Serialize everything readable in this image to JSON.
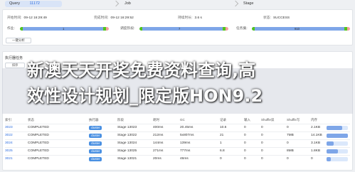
{
  "breadcrumb": {
    "query_label": "Query",
    "query_id": "11172",
    "job_label": "Job",
    "stage_label": "Stage"
  },
  "summary": {
    "start_time_label": "开始时间:",
    "start_time": "09-12 16:29:49",
    "end_time_label": "完成时间:",
    "end_time": "09-12 16:29:52",
    "duration_label": "持续时长:",
    "duration": "3.6 s",
    "status_label": "状态:",
    "status": "SUCCESS",
    "jobs_label": "作业:",
    "jobs_done": "1",
    "schedule_label": "调度阶段:",
    "schedule_done": "7",
    "tasks_label": "任务集:",
    "tasks_done": "910"
  },
  "buttons": {
    "reset": "一键分析",
    "filter": "排序"
  },
  "tasks": {
    "title": "执行器任务",
    "columns": [
      "索引",
      "状态",
      "执行器",
      "阶段",
      "耗时",
      "GC",
      "记录",
      "输入",
      "Shuffle读",
      "Shuffle写",
      "内存"
    ],
    "rows": [
      {
        "id": "3023",
        "status": "COMPLETED",
        "exec": "cluster",
        "stage": "Stage 13023",
        "time": "400ms",
        "gc": "20.45ms",
        "rec": "10.6",
        "a": "0",
        "b": "0",
        "c": "0",
        "size": "2.1KB"
      },
      {
        "id": "3022",
        "status": "COMPLETED",
        "exec": "cluster",
        "stage": "Stage 13022",
        "time": "212ms",
        "gc": "5x807ms",
        "rec": "21",
        "a": "0",
        "b": "0",
        "c": "7MB",
        "size": "14.1KB"
      },
      {
        "id": "3024",
        "status": "COMPLETED",
        "exec": "cluster",
        "stage": "Stage 13024",
        "time": "144ms",
        "gc": "139ms",
        "rec": "1",
        "a": "0",
        "b": "0",
        "c": "0",
        "size": "3.1KB"
      },
      {
        "id": "3025",
        "status": "COMPLETED",
        "exec": "cluster",
        "stage": "Stage 13025",
        "time": "271ms",
        "gc": "777ms",
        "rec": "6.8",
        "a": "0",
        "b": "0",
        "c": "8MB",
        "size": "1.8KB"
      },
      {
        "id": "3021",
        "status": "COMPLETED",
        "exec": "cluster",
        "stage": "Stage 13021",
        "time": "20ms",
        "gc": "46ms",
        "rec": "0",
        "a": "0",
        "b": "0",
        "c": "0",
        "size": "0"
      }
    ]
  },
  "headline": {
    "line1": "新澳天天开奖免费资料查询,高",
    "line2": "效性设计规划_限定版HON9.2"
  },
  "colors": {
    "accent": "#2f6fe0",
    "progress": "#7ea6e8",
    "success": "#52c41a"
  },
  "progress": {
    "jobs_fraction": 0.98,
    "schedule_fraction": 0.97,
    "tasks_fraction": 0.97
  }
}
